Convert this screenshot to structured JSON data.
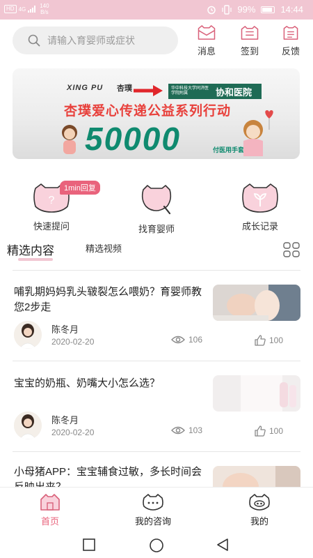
{
  "status_bar": {
    "network": "HD",
    "signal": "4G",
    "speed": "140",
    "speed_unit": "B/s",
    "battery": "99%",
    "time": "14:44"
  },
  "header": {
    "search_placeholder": "请输入育婴师或症状",
    "actions": [
      {
        "label": "消息",
        "icon": "envelope-icon"
      },
      {
        "label": "签到",
        "icon": "calendar-icon"
      },
      {
        "label": "反馈",
        "icon": "feedback-icon"
      }
    ]
  },
  "banner": {
    "brand_left": "XING PU",
    "brand_left_cn": "杏璞",
    "partner_small": "华中科技大学同济医学院附属",
    "partner_name": "协和医院",
    "headline": "杏璞爱心传递公益系列行动",
    "number": "50000",
    "sub": "付医用手套"
  },
  "quick_entries": [
    {
      "label": "快速提问",
      "icon": "question-bubble-icon",
      "badge": "1min回复"
    },
    {
      "label": "找育婴师",
      "icon": "search-bubble-icon"
    },
    {
      "label": "成长记录",
      "icon": "sprout-icon"
    }
  ],
  "tabs": {
    "active": "精选内容",
    "second": "精选视频"
  },
  "articles": [
    {
      "title": "哺乳期妈妈乳头皲裂怎么喂奶？育婴师教您2步走",
      "author": "陈冬月",
      "date": "2020-02-20",
      "views": "106",
      "likes": "100"
    },
    {
      "title": "宝宝的奶瓶、奶嘴大小怎么选？",
      "author": "陈冬月",
      "date": "2020-02-20",
      "views": "103",
      "likes": "100"
    },
    {
      "title": "小母猪APP：宝宝辅食过敏，多长时间会反映出来？",
      "author": "",
      "date": "",
      "views": "",
      "likes": ""
    }
  ],
  "bottom_nav": [
    {
      "label": "首页",
      "active": true
    },
    {
      "label": "我的咨询",
      "active": false
    },
    {
      "label": "我的",
      "active": false
    }
  ],
  "colors": {
    "accent": "#f1c6d2",
    "accent_text": "#e9637c",
    "badge": "#e9637c"
  }
}
